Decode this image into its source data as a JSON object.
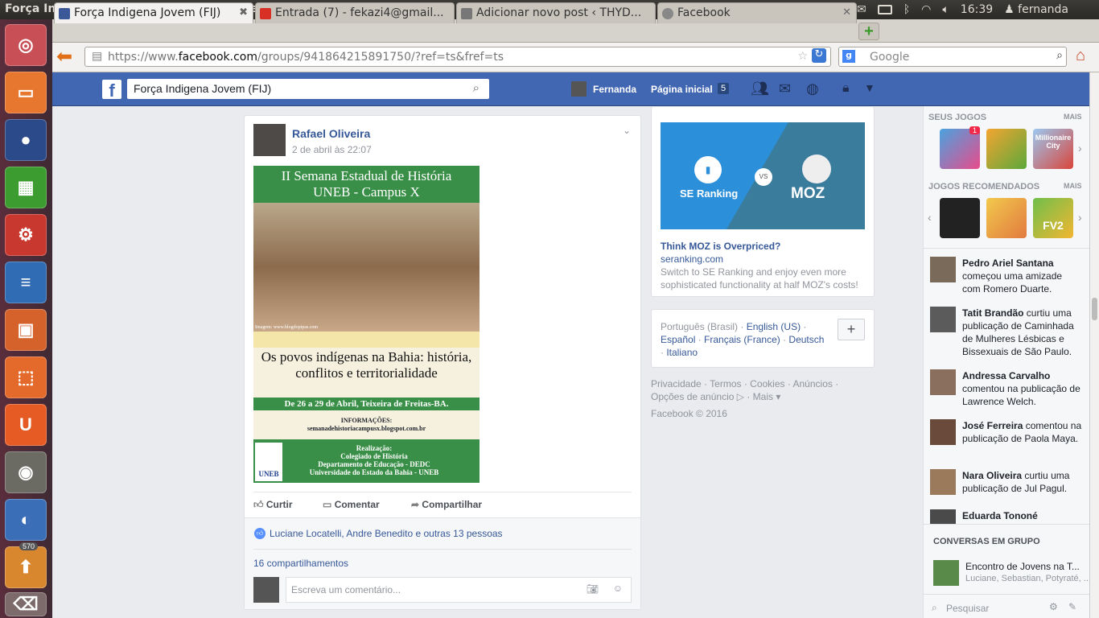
{
  "window": {
    "title": "Força Indigena Jovem (FIJ) - Mozilla Firefox"
  },
  "tray": {
    "time": "16:39",
    "user": "fernanda"
  },
  "launcher": {
    "badge": "570"
  },
  "tabs": [
    {
      "label": "Força Indigena Jovem (FIJ)"
    },
    {
      "label": "Entrada (7) - fekazi4@gmail..."
    },
    {
      "label": "Adicionar novo post ‹ THYD..."
    },
    {
      "label": "Facebook"
    }
  ],
  "url": {
    "prefix": "https://www.",
    "domain": "facebook.com",
    "path": "/groups/941864215891750/?ref=ts&fref=ts"
  },
  "search": {
    "placeholder": "Google"
  },
  "fb": {
    "search_value": "Força Indigena Jovem (FIJ)",
    "user": "Fernanda",
    "home": "Página inicial",
    "home_count": "5"
  },
  "post": {
    "author": "Rafael Oliveira",
    "time": "2 de abril às 22:07",
    "poster": {
      "title1": "II Semana  Estadual de História",
      "title2": "UNEB - Campus X",
      "watermark": "Imagem: www.blogdopipas.com",
      "subtitle": "Os povos indígenas na Bahia: história, conflitos e territorialidade",
      "dates": "De 26 a 29 de Abril, Teixeira de Freitas-BA.",
      "info": "INFORMAÇÕES:",
      "site": "semanadehistoriacampusx.blogspot.com.br",
      "real": "Realização:",
      "org1": "Colegiado de História",
      "org2": "Departamento de Educação - DEDC",
      "org3": "Universidade do Estado da Bahia - UNEB",
      "logo": "UNEB"
    },
    "like": "Curtir",
    "comment": "Comentar",
    "share": "Compartilhar",
    "likes_text": "Luciane Locatelli, Andre Benedito e outras 13 pessoas",
    "shares": "16 compartilhamentos",
    "comment_placeholder": "Escreva um comentário..."
  },
  "ad": {
    "brand1": "SE Ranking",
    "vs": "VS",
    "brand2": "MOZ",
    "title": "Think MOZ is Overpriced?",
    "domain": "seranking.com",
    "desc": "Switch to SE Ranking and enjoy even more sophisticated functionality at half MOZ's costs!"
  },
  "langs": {
    "current": "Português (Brasil)",
    "l1": "English (US)",
    "l2": "Español",
    "l3": "Français (France)",
    "l4": "Deutsch",
    "l5": "Italiano",
    "plus": "+"
  },
  "footer": {
    "l1": "Privacidade · Termos · Cookies · Anúncios ·",
    "l2": "Opções de anúncio",
    "l3": "· Mais ▾",
    "copy": "Facebook © 2016"
  },
  "sidebar": {
    "games_h": "Seus jogos",
    "more": "Mais",
    "rec_h": "Jogos recomendados",
    "badge": "1",
    "game3": "Millionaire City",
    "game6": "FV2",
    "activity": [
      {
        "name": "Pedro Ariel Santana",
        "text": "começou uma amizade com Romero Duarte."
      },
      {
        "name": "Tatit Brandão",
        "text": "curtiu uma publicação de Caminhada de Mulheres Lésbicas e Bissexuais de São Paulo."
      },
      {
        "name": "Andressa Carvalho",
        "text": "comentou na publicação de Lawrence Welch."
      },
      {
        "name": "José Ferreira",
        "text": "comentou na publicação de Paola Maya."
      },
      {
        "name": "Nara Oliveira",
        "text": "curtiu uma publicação de Jul Pagul."
      },
      {
        "name": "Eduarda Tononé",
        "text": ""
      }
    ],
    "chat_h": "Conversas em grupo",
    "chat_name": "Encontro de Jovens na T...",
    "chat_members": "Luciane, Sebastian, Potyraté, ...",
    "chat_search": "Pesquisar"
  }
}
